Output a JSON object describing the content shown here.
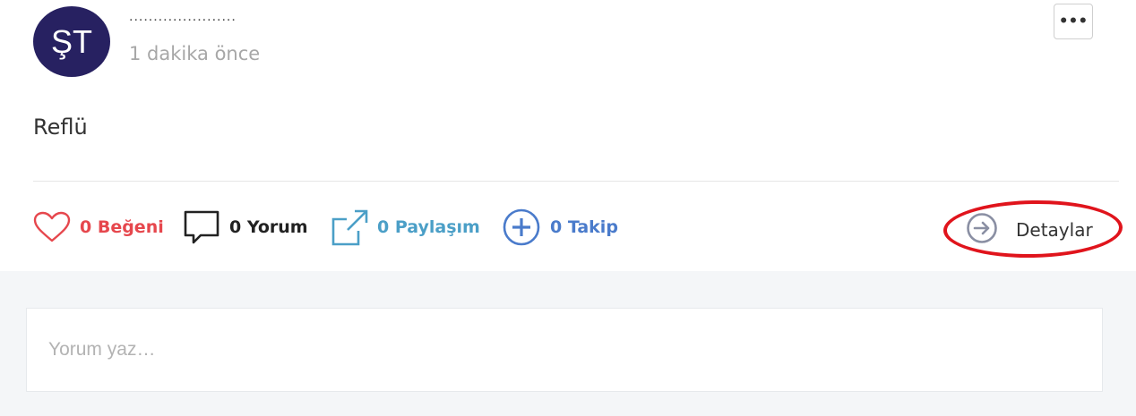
{
  "post": {
    "avatar_initials": "ŞT",
    "username": "......................",
    "timestamp": "1 dakika önce",
    "content": "Reflü",
    "menu_label": "•••"
  },
  "actions": {
    "like_label": "0 Beğeni",
    "comment_label": "0 Yorum",
    "share_label": "0 Paylaşım",
    "follow_label": "0 Takip",
    "details_label": "Detaylar"
  },
  "comment_box": {
    "placeholder": "Yorum yaz…"
  },
  "colors": {
    "avatar_bg": "#272161",
    "like": "#e6474d",
    "share": "#4b9fc7",
    "follow": "#4a7bcb",
    "highlight": "#e0141c"
  },
  "icons": [
    "heart-icon",
    "speech-bubble-icon",
    "external-link-icon",
    "plus-circle-icon",
    "arrow-right-circle-icon",
    "ellipsis-icon"
  ]
}
